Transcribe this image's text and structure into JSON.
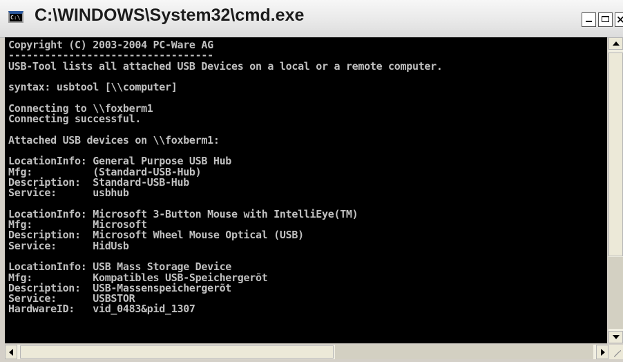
{
  "window": {
    "title": "C:\\WINDOWS\\System32\\cmd.exe",
    "icon_label": "C:\\",
    "buttons": {
      "minimize": "minimize-icon",
      "maximize": "maximize-icon",
      "close_glyph": "×"
    }
  },
  "console": {
    "foreground": "#c0c0c0",
    "background": "#000000",
    "lines": [
      "Copyright (C) 2003-2004 PC-Ware AG",
      "----------------------------------",
      "USB-Tool lists all attached USB Devices on a local or a remote computer.",
      "",
      "syntax: usbtool [\\\\computer]",
      "",
      "Connecting to \\\\foxberm1",
      "Connecting successful.",
      "",
      "Attached USB devices on \\\\foxberm1:",
      "",
      "LocationInfo: General Purpose USB Hub",
      "Mfg:          (Standard-USB-Hub)",
      "Description:  Standard-USB-Hub",
      "Service:      usbhub",
      "",
      "LocationInfo: Microsoft 3-Button Mouse with IntelliEye(TM)",
      "Mfg:          Microsoft",
      "Description:  Microsoft Wheel Mouse Optical (USB)",
      "Service:      HidUsb",
      "",
      "LocationInfo: USB Mass Storage Device",
      "Mfg:          Kompatibles USB-Speichergerõt",
      "Description:  USB-Massenspeichergerõt",
      "Service:      USBSTOR",
      "HardwareID:   vid_0483&pid_1307"
    ]
  }
}
